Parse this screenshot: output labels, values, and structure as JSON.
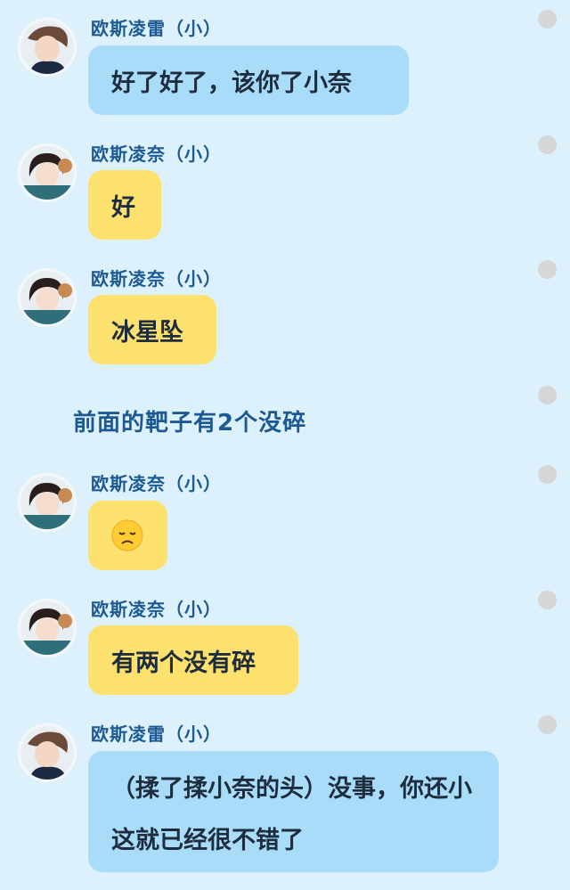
{
  "messages": [
    {
      "sender": "欧斯凌雷（小）",
      "text": "好了好了，该你了小奈",
      "avatar": "boy-avatar"
    },
    {
      "sender": "欧斯凌奈（小）",
      "text": "好",
      "avatar": "girl-avatar"
    },
    {
      "sender": "欧斯凌奈（小）",
      "text": "冰星坠",
      "avatar": "girl-avatar"
    },
    {
      "sender": "欧斯凌奈（小）",
      "text": "",
      "emoji": "disappointed-face-emoji",
      "avatar": "girl-avatar"
    },
    {
      "sender": "欧斯凌奈（小）",
      "text": "有两个没有碎",
      "avatar": "girl-avatar"
    },
    {
      "sender": "欧斯凌雷（小）",
      "text": "（揉了揉小奈的头）没事，你还小这就已经很不错了",
      "avatar": "boy-avatar"
    }
  ],
  "narration": "前面的靶子有2个没碎",
  "colors": {
    "background": "#dcf1fb",
    "blue_bubble": "#a9dcf8",
    "yellow_bubble": "#fde16f",
    "name_text": "#1d5a93",
    "dot": "#d6d6d6"
  }
}
